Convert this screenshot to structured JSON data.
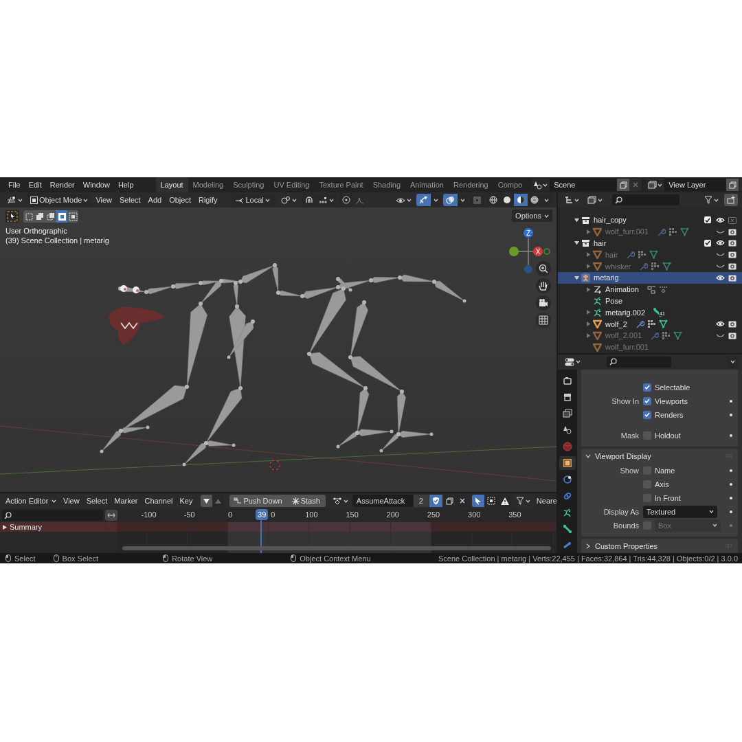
{
  "top_bar": {
    "menus": [
      "File",
      "Edit",
      "Render",
      "Window",
      "Help"
    ],
    "workspaces": [
      {
        "label": "Layout",
        "selected": true
      },
      {
        "label": "Modeling",
        "selected": false
      },
      {
        "label": "Sculpting",
        "selected": false
      },
      {
        "label": "UV Editing",
        "selected": false
      },
      {
        "label": "Texture Paint",
        "selected": false
      },
      {
        "label": "Shading",
        "selected": false
      },
      {
        "label": "Animation",
        "selected": false
      },
      {
        "label": "Rendering",
        "selected": false
      },
      {
        "label": "Compo",
        "selected": false
      }
    ],
    "scene": "Scene",
    "view_layer": "View Layer"
  },
  "viewport": {
    "mode": "Object Mode",
    "menus": [
      "View",
      "Select",
      "Add",
      "Object",
      "Rigify"
    ],
    "orientation": "Local",
    "header_toggles": [
      {
        "kind": "snap",
        "on": false
      },
      {
        "kind": "proportional",
        "on": false
      },
      {
        "kind": "gizmos",
        "on": true
      },
      {
        "kind": "overlays",
        "on": true
      },
      {
        "kind": "xray",
        "on": false
      }
    ],
    "shading": [
      {
        "kind": "wireframe",
        "selected": false
      },
      {
        "kind": "solid",
        "selected": false
      },
      {
        "kind": "material",
        "selected": true
      },
      {
        "kind": "rendered",
        "selected": false
      }
    ],
    "select_modes": [
      {
        "kind": "set",
        "selected": false
      },
      {
        "kind": "extend",
        "selected": false
      },
      {
        "kind": "subtract",
        "selected": false
      },
      {
        "kind": "invert",
        "selected": true
      },
      {
        "kind": "intersect",
        "selected": false
      }
    ],
    "options": "Options",
    "info": [
      "User Orthographic",
      "(39) Scene Collection | metarig"
    ],
    "gizmo_labels": [
      "Z",
      "X"
    ]
  },
  "action_editor": {
    "editor": "Action Editor",
    "menus": [
      "View",
      "Select",
      "Marker",
      "Channel",
      "Key"
    ],
    "push_down": "Push Down",
    "stash": "Stash",
    "action": "AssumeAttack",
    "users": "2",
    "fake_user": true,
    "only_selected": true,
    "snapping": "Neare",
    "ticks": [
      "-100",
      "-50",
      "0",
      "0",
      "100",
      "150",
      "200",
      "250",
      "300",
      "350"
    ],
    "current_frame": "39",
    "channels": [
      {
        "name": "Summary",
        "expanded": false
      }
    ]
  },
  "outliner": {
    "tree": [
      {
        "name": "hair_copy",
        "kind": "collection",
        "expanded": true,
        "selected": false,
        "dimmed": false,
        "enabled": true,
        "visible": true,
        "renderable": false,
        "children": [
          {
            "name": "wolf_furr.001",
            "kind": "mesh",
            "expanded": false,
            "selected": false,
            "dimmed": true,
            "visible": false,
            "renderable": true,
            "data": [
              {
                "kind": "modifier"
              },
              {
                "kind": "groups"
              },
              {
                "kind": "mesh"
              }
            ]
          }
        ]
      },
      {
        "name": "hair",
        "kind": "collection",
        "expanded": true,
        "selected": false,
        "dimmed": false,
        "enabled": true,
        "visible": true,
        "renderable": true,
        "children": [
          {
            "name": "hair",
            "kind": "mesh",
            "expanded": false,
            "selected": false,
            "dimmed": true,
            "visible": false,
            "renderable": true,
            "data": [
              {
                "kind": "modifier"
              },
              {
                "kind": "groups"
              },
              {
                "kind": "mesh"
              }
            ]
          },
          {
            "name": "whisker",
            "kind": "mesh",
            "expanded": false,
            "selected": false,
            "dimmed": true,
            "visible": false,
            "renderable": true,
            "data": [
              {
                "kind": "modifier"
              },
              {
                "kind": "groups"
              },
              {
                "kind": "mesh"
              }
            ]
          }
        ]
      },
      {
        "name": "metarig",
        "kind": "armature",
        "expanded": true,
        "selected": true,
        "dimmed": false,
        "visible": true,
        "renderable": true,
        "children": [
          {
            "name": "Animation",
            "kind": "animation",
            "expanded": false,
            "selected": false,
            "dimmed": false,
            "data": [
              {
                "kind": "action"
              },
              {
                "kind": "drivers"
              }
            ]
          },
          {
            "name": "Pose",
            "kind": "pose",
            "selected": false,
            "dimmed": false
          },
          {
            "name": "metarig.002",
            "kind": "armature_data",
            "expanded": false,
            "selected": false,
            "dimmed": false,
            "data": [
              {
                "kind": "bones",
                "count": "41"
              }
            ]
          },
          {
            "name": "wolf_2",
            "kind": "mesh",
            "expanded": false,
            "selected": false,
            "dimmed": false,
            "visible": true,
            "renderable": true,
            "data": [
              {
                "kind": "modifier"
              },
              {
                "kind": "groups"
              },
              {
                "kind": "mesh"
              }
            ]
          },
          {
            "name": "wolf_2.001",
            "kind": "mesh",
            "expanded": false,
            "selected": false,
            "dimmed": true,
            "visible": false,
            "renderable": true,
            "data": [
              {
                "kind": "modifier"
              },
              {
                "kind": "groups"
              },
              {
                "kind": "mesh"
              }
            ]
          },
          {
            "name": "wolf_furr.001",
            "kind": "mesh",
            "selected": false,
            "dimmed": true
          }
        ]
      }
    ]
  },
  "properties": {
    "tabs": [
      {
        "kind": "render",
        "selected": false
      },
      {
        "kind": "output",
        "selected": false
      },
      {
        "kind": "view_layer",
        "selected": false
      },
      {
        "kind": "scene",
        "selected": false
      },
      {
        "kind": "world",
        "selected": false
      },
      {
        "kind": "object",
        "selected": true
      },
      {
        "kind": "physics",
        "selected": false
      },
      {
        "kind": "constraints",
        "selected": false
      },
      {
        "kind": "data",
        "selected": false
      },
      {
        "kind": "bone",
        "selected": false
      },
      {
        "kind": "bone_constraints",
        "selected": false
      }
    ],
    "panels": [
      {
        "rows": [
          {
            "kind": "checkbox",
            "option": "Selectable",
            "checked": true,
            "animatable": false
          },
          {
            "kind": "checkbox",
            "label": "Show In",
            "option": "Viewports",
            "checked": true,
            "animatable": true
          },
          {
            "kind": "checkbox",
            "option": "Renders",
            "checked": true,
            "animatable": true
          },
          {
            "kind": "checkbox",
            "label": "Mask",
            "option": "Holdout",
            "checked": false,
            "animatable": true
          }
        ]
      },
      {
        "title": "Viewport Display",
        "expanded": true,
        "rows": [
          {
            "kind": "checkbox",
            "label": "Show",
            "option": "Name",
            "checked": false,
            "animatable": true
          },
          {
            "kind": "checkbox",
            "option": "Axis",
            "checked": false,
            "animatable": true
          },
          {
            "kind": "checkbox",
            "option": "In Front",
            "checked": false,
            "animatable": true
          },
          {
            "kind": "dropdown",
            "label": "Display As",
            "value": "Textured",
            "disabled": false,
            "animatable": true
          },
          {
            "kind": "check_dropdown",
            "label": "Bounds",
            "checked": false,
            "value": "Box",
            "disabled": true,
            "animatable": true
          }
        ]
      },
      {
        "title": "Custom Properties",
        "expanded": false
      }
    ]
  },
  "status_bar": {
    "hints": [
      "Select",
      "Box Select",
      "Rotate View",
      "Object Context Menu"
    ],
    "stats": "Scene Collection | metarig | Verts:22,455 | Faces:32,864 | Tris:44,328 | Objects:0/2 | 3.0.0"
  }
}
